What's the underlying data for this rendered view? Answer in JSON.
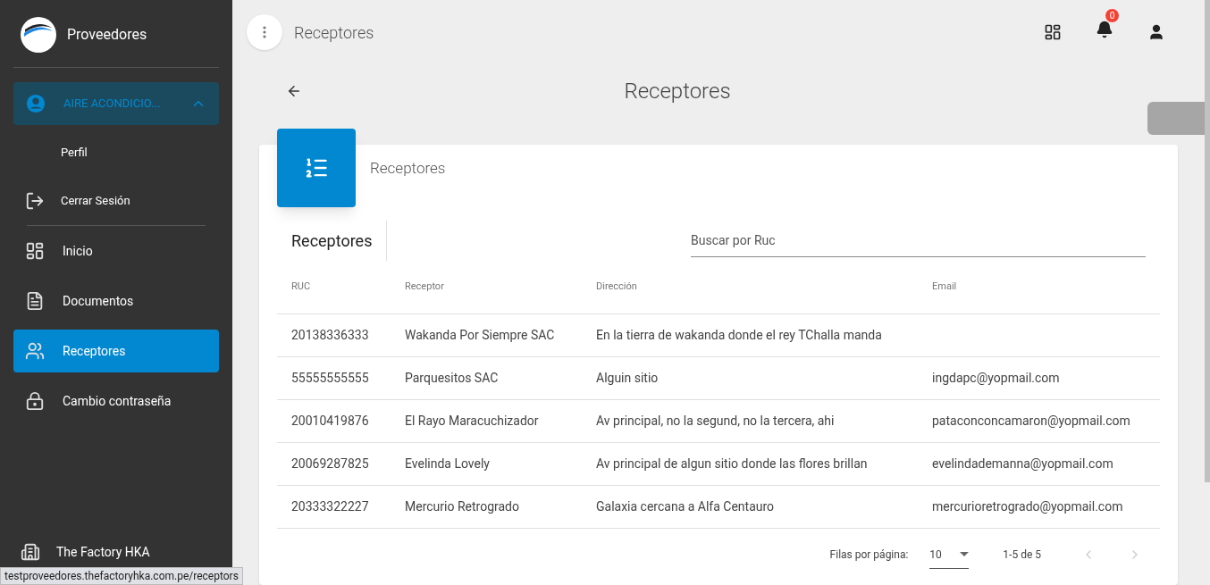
{
  "sidebar": {
    "brand": "Proveedores",
    "user": {
      "label": "AIRE ACONDICIO...",
      "expanded": true
    },
    "user_menu": [
      {
        "kind": "text",
        "label": "Perfil"
      },
      {
        "kind": "logout",
        "label": "Cerrar Sesión"
      }
    ],
    "items": [
      {
        "label": "Inicio",
        "selected": false
      },
      {
        "label": "Documentos",
        "selected": false
      },
      {
        "label": "Receptores",
        "selected": true
      },
      {
        "label": "Cambio contraseña",
        "selected": false
      }
    ],
    "footer": "The Factory HKA"
  },
  "topbar": {
    "title": "Receptores",
    "notifications": "0"
  },
  "page_title": "Receptores",
  "card": {
    "header": "Receptores",
    "table_title": "Receptores",
    "search": {
      "placeholder": "Buscar por Ruc"
    },
    "columns": [
      "RUC",
      "Receptor",
      "Dirección",
      "Email"
    ],
    "rows": [
      {
        "ruc": "20138336333",
        "receptor": "Wakanda Por Siempre SAC",
        "direccion": "En la tierra de wakanda donde el rey TChalla manda"
      },
      {
        "ruc": "55555555555",
        "receptor": "Parquesitos SAC",
        "direccion": "Alguin sitio",
        "email": "ingdapc@yopmail.com"
      },
      {
        "ruc": "20010419876",
        "receptor": "El Rayo Maracuchizador",
        "direccion": "Av principal, no la segund, no la tercera, ahi",
        "email": "pataconconcamaron@yopmail.com"
      },
      {
        "ruc": "20069287825",
        "receptor": "Evelinda Lovely",
        "direccion": "Av principal de algun sitio donde las flores brillan",
        "email": "evelindademanna@yopmail.com"
      },
      {
        "ruc": "20333322227",
        "receptor": "Mercurio Retrogrado",
        "direccion": "Galaxia cercana a Alfa Centauro",
        "email": "mercurioretrogrado@yopmail.com"
      }
    ],
    "pagination": {
      "rows_label": "Filas por página:",
      "rows_per_page": "10",
      "range": "1-5 de 5"
    }
  },
  "status_bar": "testproveedores.thefactoryhka.com.pe/receptors"
}
